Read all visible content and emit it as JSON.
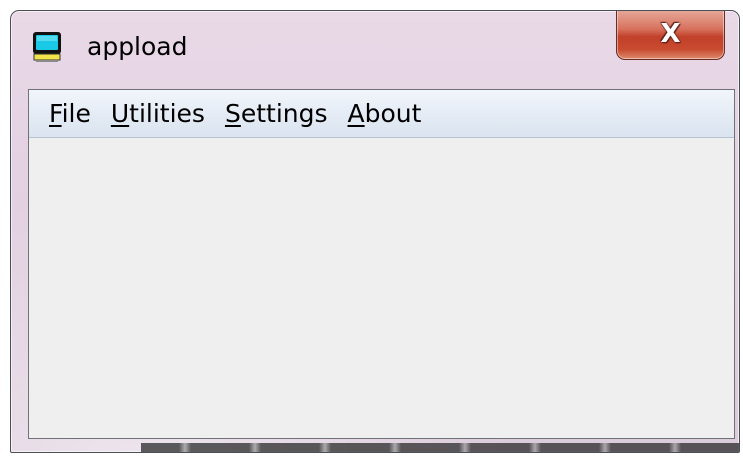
{
  "window": {
    "title": "appload",
    "close_label": "X",
    "icon": "computer-monitor-icon"
  },
  "menubar": {
    "items": [
      {
        "mnemonic": "F",
        "rest": "ile",
        "label": "File"
      },
      {
        "mnemonic": "U",
        "rest": "tilities",
        "label": "Utilities"
      },
      {
        "mnemonic": "S",
        "rest": "ettings",
        "label": "Settings"
      },
      {
        "mnemonic": "A",
        "rest": "bout",
        "label": "About"
      }
    ]
  },
  "colors": {
    "titlebar": "#e4d2e2",
    "close_button": "#c84a2f",
    "client_background": "#efefef",
    "menubar": "#e6edf6"
  }
}
